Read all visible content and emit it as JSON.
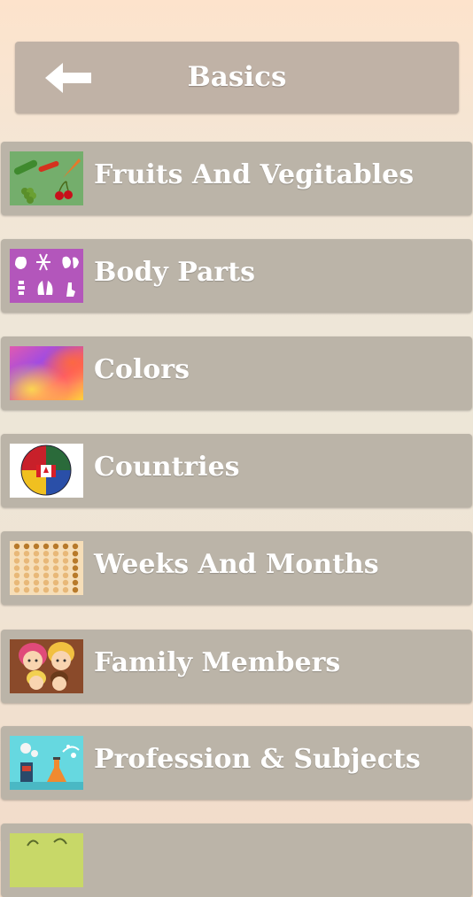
{
  "header": {
    "title": "Basics",
    "back_icon": "back-arrow-icon"
  },
  "items": [
    {
      "label": "Fruits And Vegitables",
      "icon": "fruits-vegetables-icon"
    },
    {
      "label": "Body Parts",
      "icon": "body-parts-icon"
    },
    {
      "label": "Colors",
      "icon": "colors-icon"
    },
    {
      "label": "Countries",
      "icon": "globe-flags-icon"
    },
    {
      "label": "Weeks And Months",
      "icon": "calendar-icon"
    },
    {
      "label": "Family Members",
      "icon": "family-icon"
    },
    {
      "label": "Profession & Subjects",
      "icon": "science-lab-icon"
    }
  ],
  "colors": {
    "header_bg": "#c0b2a6",
    "item_bg": "#bbb4a8",
    "text": "#ffffff"
  }
}
